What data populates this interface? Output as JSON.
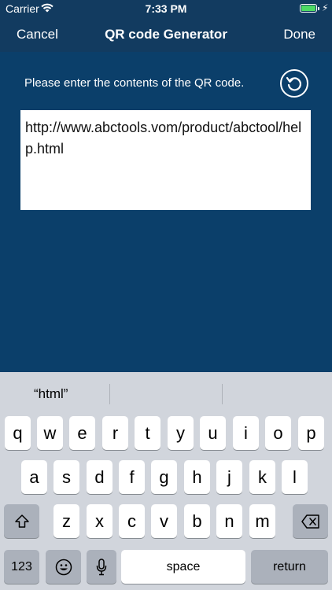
{
  "status_bar": {
    "carrier": "Carrier",
    "time": "7:33 PM"
  },
  "nav": {
    "cancel_label": "Cancel",
    "title": "QR code Generator",
    "done_label": "Done"
  },
  "form": {
    "prompt": "Please enter the contents of the QR code.",
    "text_value": "http://www.abctools.vom/product/abctool/help.html"
  },
  "keyboard": {
    "suggestions": [
      "“html”",
      "",
      ""
    ],
    "row1": [
      "q",
      "w",
      "e",
      "r",
      "t",
      "y",
      "u",
      "i",
      "o",
      "p"
    ],
    "row2": [
      "a",
      "s",
      "d",
      "f",
      "g",
      "h",
      "j",
      "k",
      "l"
    ],
    "row3": [
      "z",
      "x",
      "c",
      "v",
      "b",
      "n",
      "m"
    ],
    "numbers_label": "123",
    "space_label": "space",
    "return_label": "return"
  },
  "colors": {
    "background": "#0b3f6a",
    "nav_bar": "#123b60",
    "keyboard": "#d1d5dc",
    "battery": "#4cd964"
  }
}
